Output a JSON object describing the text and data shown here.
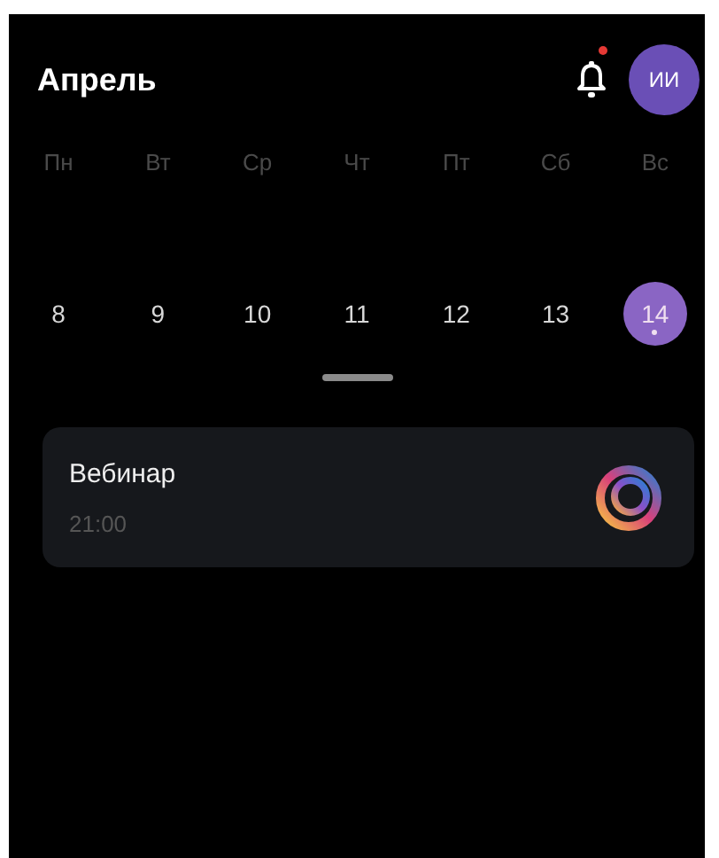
{
  "header": {
    "title": "Апрель",
    "notifications_unread": true,
    "avatar_initials": "ИИ"
  },
  "weekdays": [
    "Пн",
    "Вт",
    "Ср",
    "Чт",
    "Пт",
    "Сб",
    "Вс"
  ],
  "days": [
    {
      "label": "8",
      "selected": false,
      "has_event": false
    },
    {
      "label": "9",
      "selected": false,
      "has_event": false
    },
    {
      "label": "10",
      "selected": false,
      "has_event": false
    },
    {
      "label": "11",
      "selected": false,
      "has_event": false
    },
    {
      "label": "12",
      "selected": false,
      "has_event": false
    },
    {
      "label": "13",
      "selected": false,
      "has_event": false
    },
    {
      "label": "14",
      "selected": true,
      "has_event": true
    }
  ],
  "events": [
    {
      "title": "Вебинар",
      "time": "21:00"
    }
  ]
}
